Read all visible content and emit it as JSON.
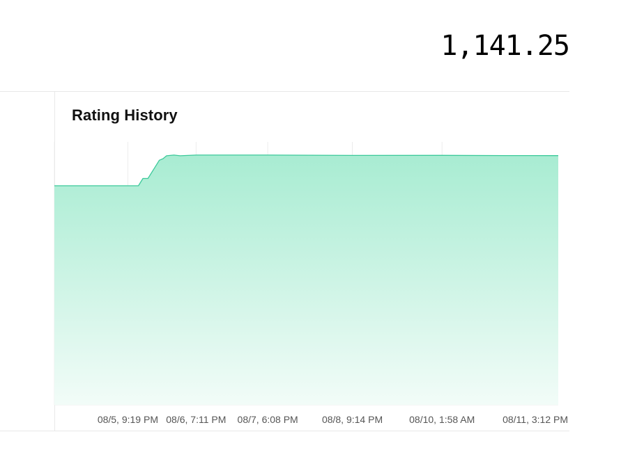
{
  "header": {
    "rating_value": "1,141.25"
  },
  "panel": {
    "title": "Rating History"
  },
  "colors": {
    "line": "#3cc99a",
    "fill_top": "#a8ecd2",
    "fill_bottom": "#f2fcf8",
    "grid": "#ececec"
  },
  "chart_data": {
    "type": "area",
    "title": "Rating History",
    "xlabel": "",
    "ylabel": "",
    "x_tick_labels": [
      "08/5, 9:19 PM",
      "08/6, 7:11 PM",
      "08/7, 6:08 PM",
      "08/8, 9:14 PM",
      "08/10, 1:58 AM",
      "08/11, 3:12 PM"
    ],
    "x_ticks": [
      "2024-08-05T21:19",
      "2024-08-06T19:11",
      "2024-08-07T18:08",
      "2024-08-08T21:14",
      "2024-08-10T01:58",
      "2024-08-11T15:12"
    ],
    "x_range": [
      "2024-08-04T21:47",
      "2024-08-11T15:12"
    ],
    "y_range": [
      800,
      1160
    ],
    "grid": "vertical",
    "legend": "none",
    "series": [
      {
        "points": [
          [
            "2024-08-04T21:47",
            1100
          ],
          [
            "2024-08-05T21:19",
            1100
          ],
          [
            "2024-08-06T00:43",
            1100
          ],
          [
            "2024-08-06T02:10",
            1110
          ],
          [
            "2024-08-06T03:46",
            1110
          ],
          [
            "2024-08-06T05:57",
            1125
          ],
          [
            "2024-08-06T07:24",
            1135
          ],
          [
            "2024-08-06T08:35",
            1137
          ],
          [
            "2024-08-06T09:44",
            1141
          ],
          [
            "2024-08-06T12:06",
            1142
          ],
          [
            "2024-08-06T14:05",
            1141
          ],
          [
            "2024-08-06T19:11",
            1142
          ],
          [
            "2024-08-07T18:08",
            1142
          ],
          [
            "2024-08-08T21:14",
            1141.5
          ],
          [
            "2024-08-10T01:58",
            1141.6
          ],
          [
            "2024-08-10T22:00",
            1141.3
          ],
          [
            "2024-08-11T15:12",
            1141.25
          ]
        ]
      }
    ]
  }
}
